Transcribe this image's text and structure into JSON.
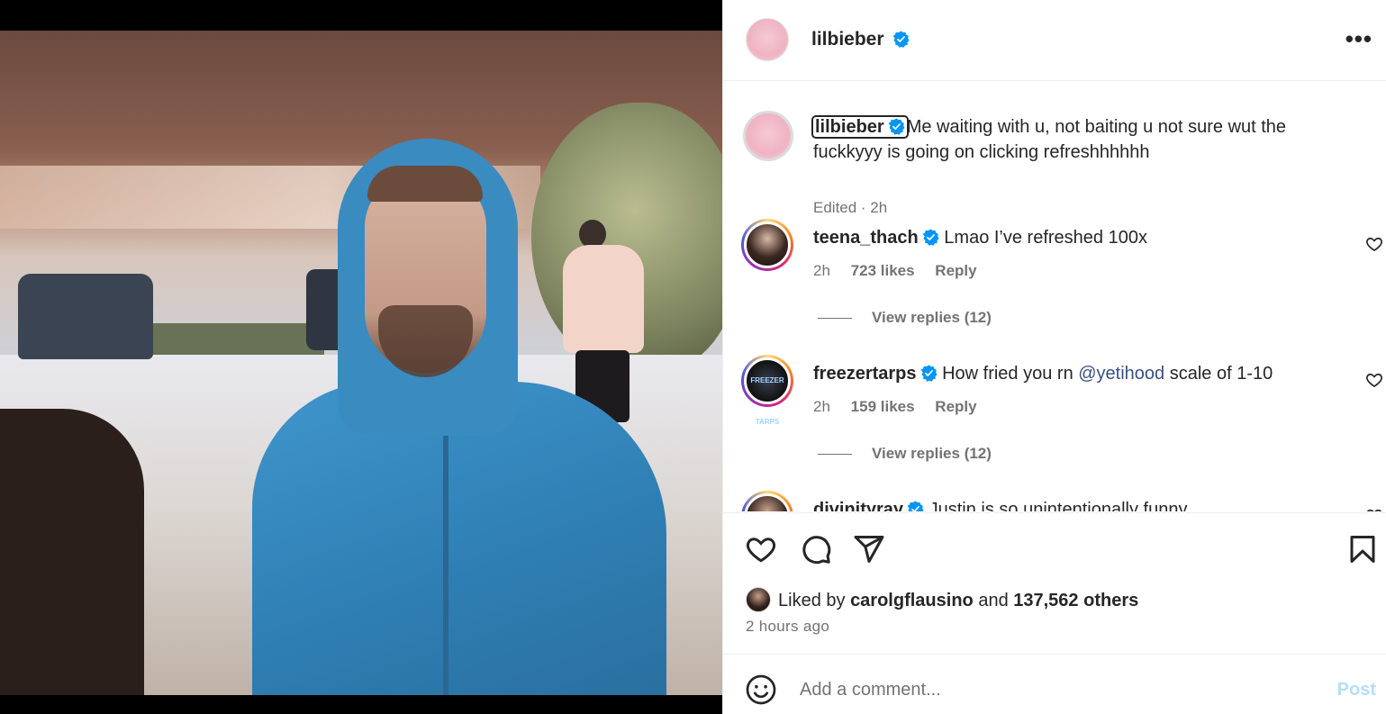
{
  "post": {
    "username": "lilbieber",
    "more_label": "•••"
  },
  "caption": {
    "username": "lilbieber",
    "text": "Me waiting with u, not baiting u not sure wut the fuckkyyy is going on clicking refreshhhhhh",
    "meta": "Edited · 2h"
  },
  "comments": [
    {
      "username": "teena_thach",
      "text": "Lmao I’ve refreshed 100x",
      "time": "2h",
      "likes": "723 likes",
      "reply": "Reply",
      "view_replies": "View replies (12)"
    },
    {
      "username": "freezertarps",
      "text_before": "How fried you rn ",
      "mention": "@yetihood",
      "text_after": " scale of 1-10",
      "time": "2h",
      "likes": "159 likes",
      "reply": "Reply",
      "view_replies": "View replies (12)",
      "avatar_text": "FREEZER TARPS"
    },
    {
      "username": "divinityray",
      "text": "Justin is so unintentionally funny"
    }
  ],
  "likes": {
    "prefix": "Liked by ",
    "user": "carolgflausino",
    "middle": " and ",
    "count": "137,562 others"
  },
  "time_ago": "2 hours ago",
  "add_comment": {
    "placeholder": "Add a comment...",
    "post_label": "Post"
  },
  "colors": {
    "verified": "#0095f6",
    "post_disabled": "#b2dffc",
    "mention": "#385185"
  },
  "icons": [
    "verified-badge-icon",
    "more-options-icon",
    "heart-icon",
    "comment-icon",
    "share-icon",
    "bookmark-icon",
    "emoji-icon"
  ]
}
